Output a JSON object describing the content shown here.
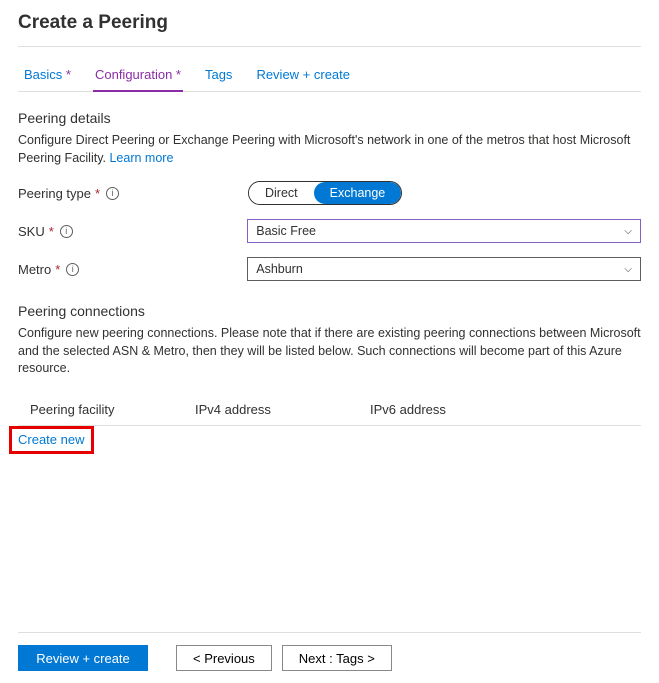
{
  "pageTitle": "Create a Peering",
  "tabs": {
    "basics": "Basics",
    "configuration": "Configuration",
    "tags": "Tags",
    "review": "Review + create"
  },
  "peeringDetails": {
    "title": "Peering details",
    "desc1": "Configure Direct Peering or Exchange Peering with Microsoft's network in one of the metros that host Microsoft Peering Facility. ",
    "learnMore": "Learn more"
  },
  "fields": {
    "peeringTypeLabel": "Peering type",
    "peeringTypeOptions": {
      "direct": "Direct",
      "exchange": "Exchange"
    },
    "skuLabel": "SKU",
    "skuValue": "Basic Free",
    "metroLabel": "Metro",
    "metroValue": "Ashburn"
  },
  "connections": {
    "title": "Peering connections",
    "desc": "Configure new peering connections. Please note that if there are existing peering connections between Microsoft and the selected ASN & Metro, then they will be listed below. Such connections will become part of this Azure resource.",
    "columns": {
      "facility": "Peering facility",
      "ipv4": "IPv4 address",
      "ipv6": "IPv6 address"
    },
    "createNew": "Create new"
  },
  "footer": {
    "review": "Review + create",
    "previous": "< Previous",
    "next": "Next : Tags >"
  }
}
